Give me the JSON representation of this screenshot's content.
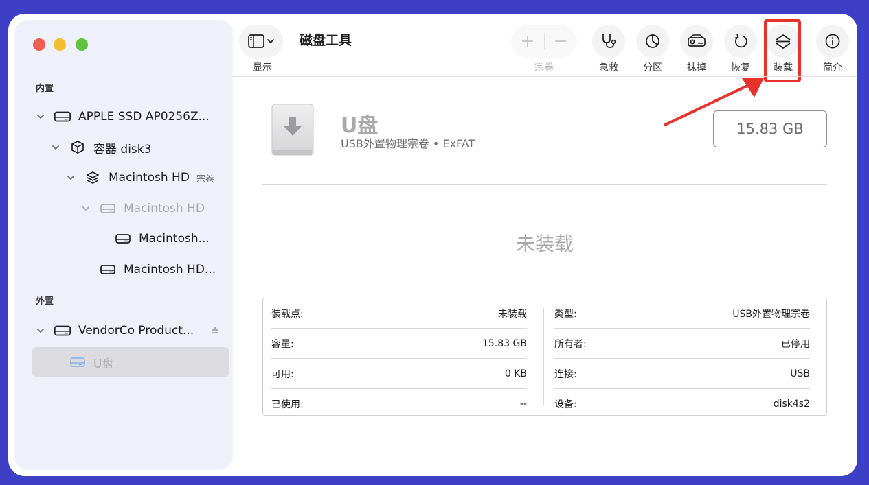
{
  "window": {
    "title": "磁盘工具"
  },
  "toolbar": {
    "view_label": "显示",
    "volume_label": "宗卷",
    "buttons": [
      {
        "label": "急救",
        "icon": "stethoscope-icon"
      },
      {
        "label": "分区",
        "icon": "pie-chart-icon"
      },
      {
        "label": "抹掉",
        "icon": "erase-drive-icon"
      },
      {
        "label": "恢复",
        "icon": "restore-icon"
      },
      {
        "label": "装载",
        "icon": "mount-icon"
      },
      {
        "label": "简介",
        "icon": "info-icon"
      }
    ],
    "colors": {
      "highlight": "#e8312a",
      "arrow": "#e8312a"
    }
  },
  "sidebar": {
    "internal_label": "内置",
    "external_label": "外置",
    "items": [
      {
        "label": "APPLE SSD AP0256Z..."
      },
      {
        "label": "容器 disk3"
      },
      {
        "label": "Macintosh HD",
        "suffix": "宗卷"
      },
      {
        "label": "Macintosh HD"
      },
      {
        "label": "Macintosh..."
      },
      {
        "label": "Macintosh HD..."
      },
      {
        "label": "VendorCo Product..."
      },
      {
        "label": "U盘"
      }
    ]
  },
  "volume": {
    "name": "U盘",
    "subtitle": "USB外置物理宗卷 • ExFAT",
    "size": "15.83 GB",
    "status": "未装载"
  },
  "info": {
    "left": [
      {
        "key": "装载点:",
        "value": "未装载"
      },
      {
        "key": "容量:",
        "value": "15.83 GB"
      },
      {
        "key": "可用:",
        "value": "0 KB"
      },
      {
        "key": "已使用:",
        "value": "--"
      }
    ],
    "right": [
      {
        "key": "类型:",
        "value": "USB外置物理宗卷"
      },
      {
        "key": "所有者:",
        "value": "已停用"
      },
      {
        "key": "连接:",
        "value": "USB"
      },
      {
        "key": "设备:",
        "value": "disk4s2"
      }
    ]
  }
}
